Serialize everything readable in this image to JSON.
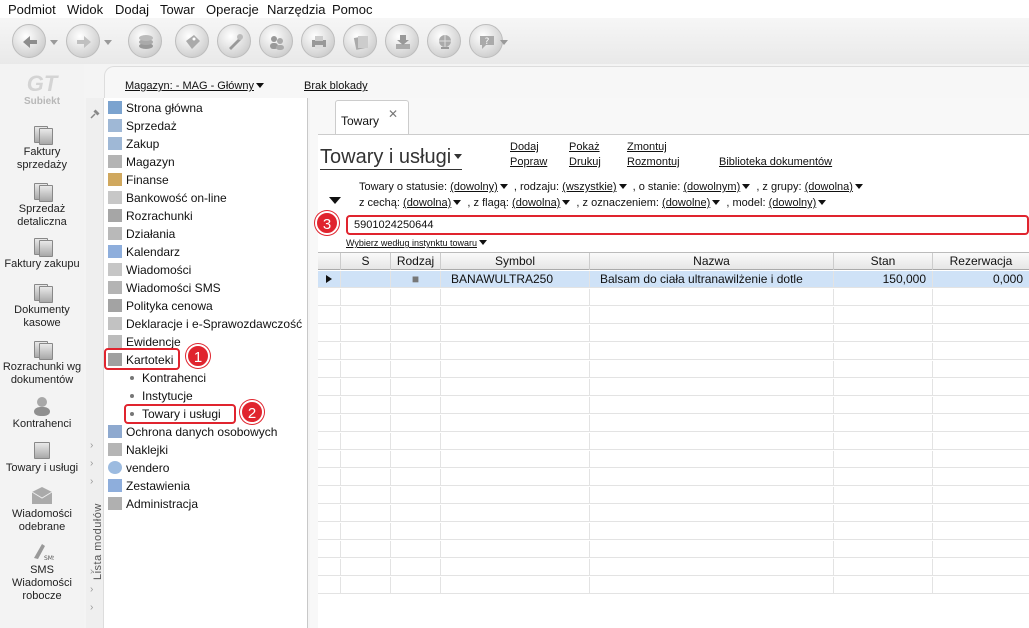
{
  "menu": [
    "Podmiot",
    "Widok",
    "Dodaj",
    "Towar",
    "Operacje",
    "Narzędzia",
    "Pomoc"
  ],
  "app_logo": "Subiekt",
  "shortcuts": [
    {
      "label": "Faktury sprzedaży",
      "icon": "coins-icon"
    },
    {
      "label": "Sprzedaż detaliczna",
      "icon": "cash-register-icon"
    },
    {
      "label": "Faktury zakupu",
      "icon": "purchase-invoice-icon"
    },
    {
      "label": "Dokumenty kasowe",
      "icon": "cash-document-icon"
    },
    {
      "label": "Rozrachunki wg dokumentów",
      "icon": "settlements-icon"
    },
    {
      "label": "Kontrahenci",
      "icon": "person-icon"
    },
    {
      "label": "Towary i usługi",
      "icon": "products-icon"
    },
    {
      "label": "Wiadomości odebrane",
      "icon": "inbox-icon"
    },
    {
      "label": "SMS Wiadomości robocze",
      "icon": "sms-icon"
    }
  ],
  "modules_strip_label": "Lista modułów",
  "modules": [
    {
      "label": "Strona główna",
      "icon": "home-icon"
    },
    {
      "label": "Sprzedaż",
      "icon": "sales-icon"
    },
    {
      "label": "Zakup",
      "icon": "purchase-icon"
    },
    {
      "label": "Magazyn",
      "icon": "warehouse-icon"
    },
    {
      "label": "Finanse",
      "icon": "finance-icon"
    },
    {
      "label": "Bankowość on-line",
      "icon": "bank-icon"
    },
    {
      "label": "Rozrachunki",
      "icon": "settlements-icon"
    },
    {
      "label": "Działania",
      "icon": "actions-icon"
    },
    {
      "label": "Kalendarz",
      "icon": "calendar-icon"
    },
    {
      "label": "Wiadomości",
      "icon": "mail-icon"
    },
    {
      "label": "Wiadomości SMS",
      "icon": "sms-icon"
    },
    {
      "label": "Polityka cenowa",
      "icon": "price-icon"
    },
    {
      "label": "Deklaracje i e-Sprawozdawczość",
      "icon": "declaration-icon"
    },
    {
      "label": "Ewidencje",
      "icon": "records-icon"
    },
    {
      "label": "Kartoteki",
      "icon": "cards-icon"
    }
  ],
  "submodules": [
    "Kontrahenci",
    "Instytucje",
    "Towary i usługi"
  ],
  "modules_after": [
    {
      "label": "Ochrona danych osobowych",
      "icon": "shield-icon"
    },
    {
      "label": "Naklejki",
      "icon": "sticker-icon"
    },
    {
      "label": "vendero",
      "icon": "vendero-icon"
    },
    {
      "label": "Zestawienia",
      "icon": "report-icon"
    },
    {
      "label": "Administracja",
      "icon": "admin-icon"
    }
  ],
  "badges": [
    "1",
    "2",
    "3"
  ],
  "topbar": {
    "warehouse": "Magazyn: - MAG - Główny",
    "lock": "Brak blokady"
  },
  "tab": {
    "label": "Towary",
    "close": "✕"
  },
  "page_title": "Towary i usługi",
  "actions": {
    "add": "Dodaj",
    "edit": "Popraw",
    "show": "Pokaż",
    "print": "Drukuj",
    "assemble": "Zmontuj",
    "disassemble": "Rozmontuj",
    "library": "Biblioteka dokumentów"
  },
  "filters": {
    "status_prefix": "Towary o statusie:",
    "status": "(dowolny)",
    "kind_prefix": ", rodzaju:",
    "kind": "(wszystkie)",
    "state_prefix": ", o stanie:",
    "state": "(dowolnym)",
    "group_prefix": ", z grupy:",
    "group": "(dowolna)",
    "feature_prefix": "z cechą:",
    "feature": "(dowolna)",
    "flag_prefix": ", z flagą:",
    "flag": "(dowolna)",
    "mark_prefix": ", z oznaczeniem:",
    "mark": "(dowolne)",
    "model_prefix": ", model:",
    "model": "(dowolny)"
  },
  "search": {
    "value": "5901024250644"
  },
  "instinct_label": "Wybierz według instynktu towaru",
  "table": {
    "columns": [
      "S",
      "Rodzaj",
      "Symbol",
      "Nazwa",
      "Stan",
      "Rezerwacja"
    ],
    "rows": [
      {
        "s": "",
        "rodzaj": "■",
        "symbol": "BANAWULTRA250",
        "nazwa": "Balsam do ciała ultranawilżenie i dotle",
        "stan": "150,000",
        "rezerwacja": "0,000"
      }
    ]
  }
}
